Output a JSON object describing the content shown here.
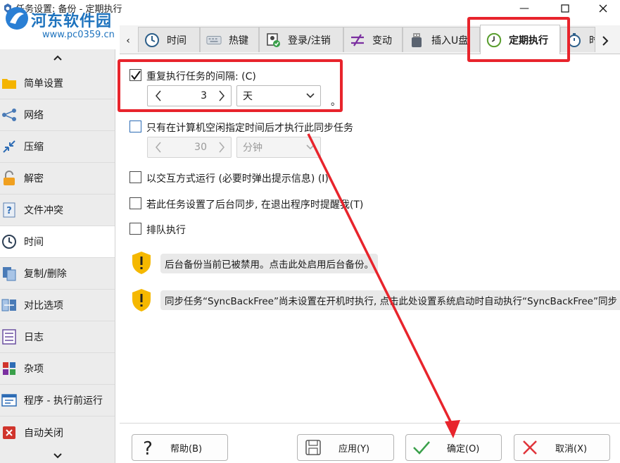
{
  "window": {
    "title": "任务设置: 备份 - 定期执行",
    "minimize_glyph": "—",
    "maximize_glyph": "☐",
    "close_glyph": "✕"
  },
  "watermark": {
    "text": "河东软件园",
    "url": "www.pc0359.cn"
  },
  "tabs": [
    {
      "label": "时间",
      "icon": "clock-icon"
    },
    {
      "label": "热键",
      "icon": "keyboard-icon"
    },
    {
      "label": "登录/注销",
      "icon": "login-icon"
    },
    {
      "label": "变动",
      "icon": "change-icon"
    },
    {
      "label": "插入U盘",
      "icon": "usb-icon"
    },
    {
      "label": "定期执行",
      "icon": "timer-icon",
      "active": true
    },
    {
      "label": "时",
      "icon": "stopwatch-icon"
    }
  ],
  "sidebar": {
    "items": [
      {
        "label": "简单设置",
        "icon": "folder-icon"
      },
      {
        "label": "网络",
        "icon": "network-icon"
      },
      {
        "label": "压缩",
        "icon": "compress-icon"
      },
      {
        "label": "解密",
        "icon": "lock-icon"
      },
      {
        "label": "文件冲突",
        "icon": "question-file-icon"
      },
      {
        "label": "时间",
        "icon": "clock-icon",
        "active": true
      },
      {
        "label": "复制/删除",
        "icon": "copy-icon"
      },
      {
        "label": "对比选项",
        "icon": "compare-icon"
      },
      {
        "label": "日志",
        "icon": "log-icon"
      },
      {
        "label": "杂项",
        "icon": "misc-icon"
      },
      {
        "label": "程序 - 执行前运行",
        "icon": "program-icon"
      },
      {
        "label": "自动关闭",
        "icon": "close-app-icon"
      }
    ]
  },
  "options": {
    "repeat": {
      "label": "重复执行任务的间隔: (C)",
      "checked": true,
      "value": "3",
      "unit": "天",
      "trailing": "。"
    },
    "idle": {
      "label": "只有在计算机空闲指定时间后才执行此同步任务",
      "checked": false,
      "value": "30",
      "unit": "分钟"
    },
    "interactive": {
      "label": "以交互方式运行 (必要时弹出提示信息) (I)",
      "checked": false
    },
    "background_remind": {
      "label": "若此任务设置了后台同步, 在退出程序时提醒我(T)",
      "checked": false
    },
    "queue": {
      "label": "排队执行",
      "checked": false
    }
  },
  "notices": [
    {
      "text": "后台备份当前已被禁用。点击此处启用后台备份。",
      "icon": "warning-shield-icon"
    },
    {
      "text": "同步任务“SyncBackFree”尚未设置在开机时执行, 点击此处设置系统启动时自动执行“SyncBackFree”同步",
      "icon": "warning-shield-icon"
    }
  ],
  "buttons": {
    "help": "帮助(B)",
    "apply": "应用(Y)",
    "ok": "确定(O)",
    "cancel": "取消(X)"
  },
  "colors": {
    "highlight_red": "#e8242c",
    "warning_yellow": "#f5b800",
    "active_green": "#5a9e2f"
  }
}
